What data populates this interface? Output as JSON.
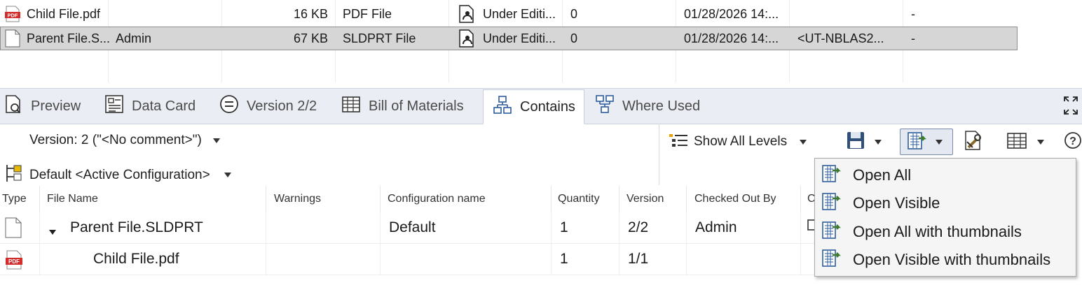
{
  "colors": {
    "accent": "#3c7a2f",
    "pdf_red": "#d42b2b",
    "selection": "#d6d6d6",
    "tab_bar": "#eaedf3"
  },
  "file_list": {
    "rows": [
      {
        "icon": "pdf-icon",
        "name": "Child File.pdf",
        "checked_out": "",
        "size": "16 KB",
        "type": "PDF File",
        "state": "Under Editi...",
        "version": "0",
        "date": "01/28/2026 14:...",
        "location": "",
        "extra": "-"
      },
      {
        "icon": "document-icon",
        "name": "Parent File.S...",
        "checked_out": "Admin",
        "size": "67 KB",
        "type": "SLDPRT File",
        "state": "Under Editi...",
        "version": "0",
        "date": "01/28/2026 14:...",
        "location": "<UT-NBLAS2...",
        "extra": "-"
      }
    ]
  },
  "tabs": [
    {
      "label": "Preview",
      "icon": "preview-icon"
    },
    {
      "label": "Data Card",
      "icon": "data-card-icon"
    },
    {
      "label": "Version 2/2",
      "icon": "version-icon"
    },
    {
      "label": "Bill of Materials",
      "icon": "bom-icon"
    },
    {
      "label": "Contains",
      "icon": "contains-icon",
      "active": true
    },
    {
      "label": "Where Used",
      "icon": "where-used-icon"
    }
  ],
  "toolbar": {
    "version_select": "Version: 2 (\"<No comment>\")",
    "config_select": "Default <Active Configuration>",
    "levels_label": "Show All Levels"
  },
  "grid": {
    "columns": [
      "Type",
      "File Name",
      "Warnings",
      "Configuration name",
      "Quantity",
      "Version",
      "Checked Out By",
      "C"
    ],
    "rows": [
      {
        "icon": "document-icon",
        "name": "Parent File.SLDPRT",
        "expanded": true,
        "warnings": "",
        "config": "Default",
        "quantity": "1",
        "version": "2/2",
        "checked_out_by": "Admin"
      },
      {
        "icon": "pdf-icon",
        "name": "Child File.pdf",
        "warnings": "",
        "config": "",
        "quantity": "1",
        "version": "1/1",
        "checked_out_by": ""
      }
    ]
  },
  "menu": {
    "items": [
      {
        "label": "Open All"
      },
      {
        "label": "Open Visible"
      },
      {
        "label": "Open All with thumbnails"
      },
      {
        "label": "Open Visible with thumbnails"
      }
    ]
  },
  "pdf_badge": "PDF"
}
